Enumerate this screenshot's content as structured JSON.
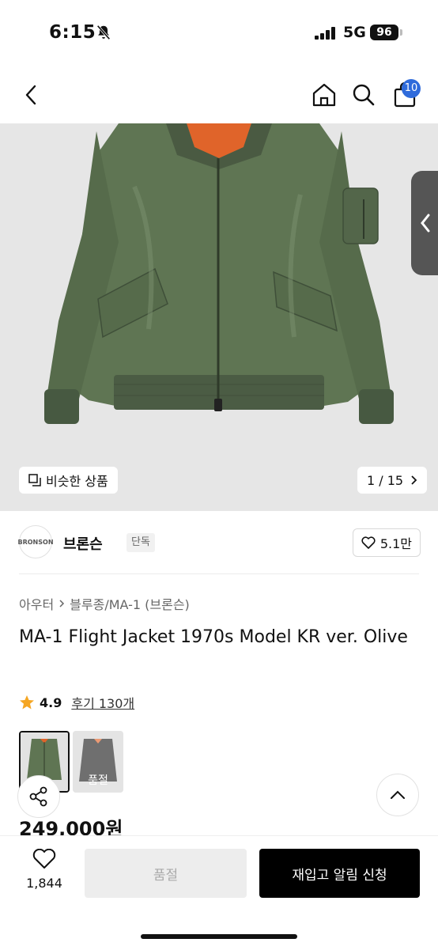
{
  "status_bar": {
    "time": "6:15",
    "network": "5G",
    "battery": "96"
  },
  "header": {
    "cart_count": "10"
  },
  "gallery": {
    "similar_label": "비슷한 상품",
    "page_indicator": "1 / 15"
  },
  "brand": {
    "logo_text": "BRONSON",
    "name": "브론슨",
    "tag": "단독",
    "likes": "5.1만"
  },
  "breadcrumb": [
    "아우터",
    "블루종/MA-1 (브론슨)"
  ],
  "product": {
    "title": "MA-1 Flight Jacket 1970s Model KR ver. Olive",
    "rating": "4.9",
    "reviews": "후기 130개",
    "price": "249,000원"
  },
  "swatches": [
    {
      "name": "olive",
      "sold_label": ""
    },
    {
      "name": "black",
      "sold_label": "품절"
    }
  ],
  "bottom_bar": {
    "wish_count": "1,844",
    "soldout_label": "품절",
    "restock_label": "재입고 알림 신청"
  },
  "colors": {
    "accent_blue": "#2f6bdb",
    "star": "#f5a623",
    "jacket_olive": "#5f7553",
    "lining_orange": "#e0642a"
  }
}
